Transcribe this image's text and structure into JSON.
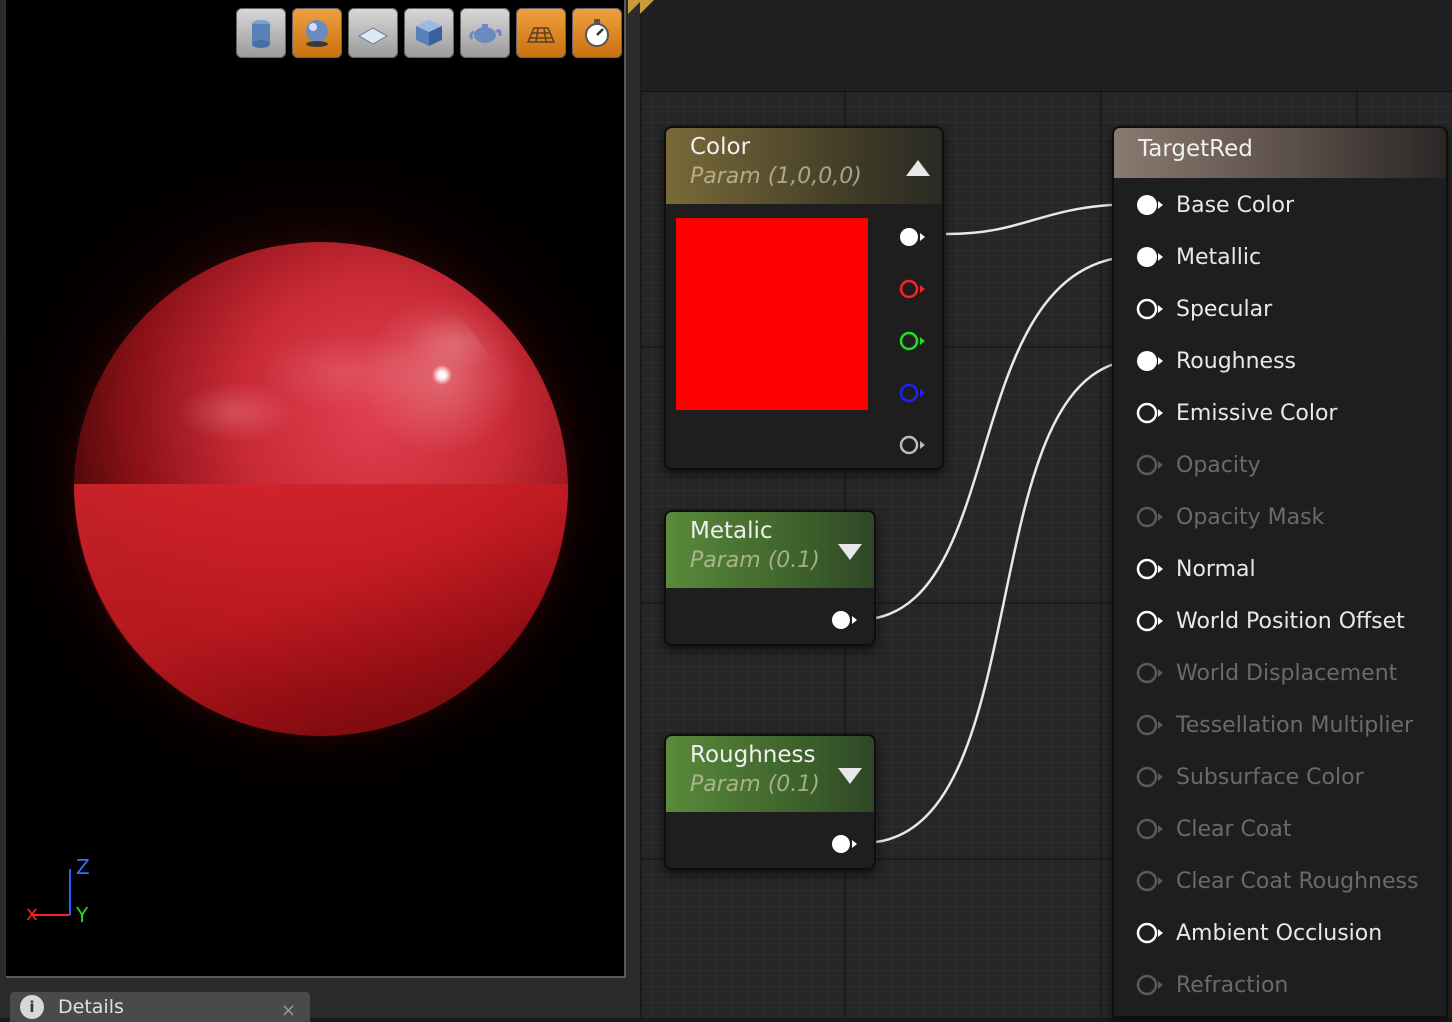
{
  "preview": {
    "toolbar": [
      {
        "icon": "cylinder-icon",
        "active": false
      },
      {
        "icon": "sphere-icon",
        "active": true
      },
      {
        "icon": "plane-icon",
        "active": false
      },
      {
        "icon": "cube-icon",
        "active": false
      },
      {
        "icon": "teapot-icon",
        "active": false
      },
      {
        "icon": "grid-floor-icon",
        "active": true
      },
      {
        "icon": "realtime-icon",
        "active": true
      }
    ],
    "axis": {
      "z": "Z",
      "y": "Y",
      "x": "x"
    },
    "details_tab": {
      "label": "Details",
      "close": "×"
    }
  },
  "nodes": {
    "color": {
      "title": "Color",
      "subtitle": "Param (1,0,0,0)",
      "swatch_color": "#ff0000",
      "outputs": [
        "#ffffff",
        "#ff2020",
        "#20e020",
        "#2020ff",
        "#bbbbbb"
      ]
    },
    "metalic": {
      "title": "Metalic",
      "subtitle": "Param (0.1)"
    },
    "roughness": {
      "title": "Roughness",
      "subtitle": "Param (0.1)"
    },
    "target": {
      "title": "TargetRed",
      "inputs": [
        {
          "label": "Base Color",
          "connected": true,
          "enabled": true
        },
        {
          "label": "Metallic",
          "connected": true,
          "enabled": true
        },
        {
          "label": "Specular",
          "connected": false,
          "enabled": true
        },
        {
          "label": "Roughness",
          "connected": true,
          "enabled": true
        },
        {
          "label": "Emissive Color",
          "connected": false,
          "enabled": true
        },
        {
          "label": "Opacity",
          "connected": false,
          "enabled": false
        },
        {
          "label": "Opacity Mask",
          "connected": false,
          "enabled": false
        },
        {
          "label": "Normal",
          "connected": false,
          "enabled": true
        },
        {
          "label": "World Position Offset",
          "connected": false,
          "enabled": true
        },
        {
          "label": "World Displacement",
          "connected": false,
          "enabled": false
        },
        {
          "label": "Tessellation Multiplier",
          "connected": false,
          "enabled": false
        },
        {
          "label": "Subsurface Color",
          "connected": false,
          "enabled": false
        },
        {
          "label": "Clear Coat",
          "connected": false,
          "enabled": false
        },
        {
          "label": "Clear Coat Roughness",
          "connected": false,
          "enabled": false
        },
        {
          "label": "Ambient Occlusion",
          "connected": false,
          "enabled": true
        },
        {
          "label": "Refraction",
          "connected": false,
          "enabled": false
        }
      ]
    }
  }
}
